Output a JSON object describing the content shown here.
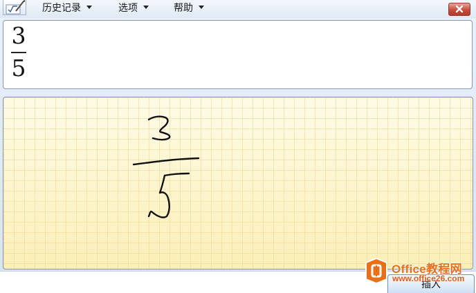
{
  "menu": {
    "history": "历史记录",
    "options": "选项",
    "help": "帮助"
  },
  "preview": {
    "numerator": "3",
    "denominator": "5"
  },
  "actions": {
    "insert_label": "插入"
  },
  "watermark": {
    "title": "Office教程网",
    "url": "www.office26.com"
  },
  "colors": {
    "close_button": "#c74d3c",
    "pad_background": "#fdf6cf",
    "watermark_orange": "#e8701a"
  },
  "icons": {
    "app": "math-input-icon",
    "close": "close-icon",
    "watermark": "office-logo-icon"
  }
}
